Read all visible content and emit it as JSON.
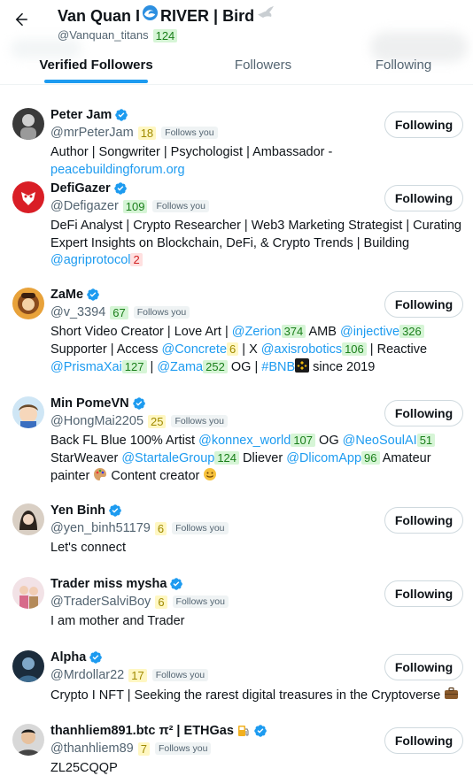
{
  "header": {
    "title_prefix": "Van Quan I",
    "title_suffix": "RIVER | Bird",
    "handle": "@Vanquan_titans",
    "handle_count": "124"
  },
  "tabs": [
    {
      "label": "Verified Followers"
    },
    {
      "label": "Followers"
    },
    {
      "label": "Following"
    }
  ],
  "colors": {
    "accent": "#1d9bf0",
    "verified": "#1d9bf0",
    "count_green_bg": "#d6f5d6",
    "count_yellow_bg": "#fff7c2",
    "count_red_bg": "#ffe0e0"
  },
  "users": [
    {
      "name": "Peter Jam",
      "handle": "@mrPeterJam",
      "count": "18",
      "count_color": "yellow",
      "follows_you": "Follows you",
      "button": "Following",
      "bio": [
        {
          "t": "Author | Songwriter | Psychologist | Ambassador - "
        },
        {
          "t": "peacebuildingforum.org",
          "link": true
        }
      ]
    },
    {
      "name": "DefiGazer",
      "handle": "@Defigazer",
      "count": "109",
      "count_color": "green",
      "follows_you": "Follows you",
      "button": "Following",
      "bio": [
        {
          "t": "DeFi Analyst | Crypto Researcher | Web3 Marketing Strategist | Curating Expert Insights on Blockchain, DeFi, & Crypto Trends | Building "
        },
        {
          "t": "@agriprotocol",
          "link": true
        },
        {
          "t": "2",
          "count": "red"
        }
      ]
    },
    {
      "name": "ZaMe",
      "handle": "@v_3394",
      "count": "67",
      "count_color": "green",
      "follows_you": "Follows you",
      "button": "Following",
      "bio": [
        {
          "t": "Short Video Creator | Love Art | "
        },
        {
          "t": "@Zerion",
          "link": true
        },
        {
          "t": "374",
          "count": "green"
        },
        {
          "t": " AMB "
        },
        {
          "t": "@injective",
          "link": true
        },
        {
          "t": "326",
          "count": "green"
        },
        {
          "t": " Supporter | Access "
        },
        {
          "t": "@Concrete",
          "link": true
        },
        {
          "t": "6",
          "count": "yellow"
        },
        {
          "t": " | X "
        },
        {
          "t": "@axisrobotics",
          "link": true
        },
        {
          "t": "106",
          "count": "green"
        },
        {
          "t": " | Reactive "
        },
        {
          "t": "@PrismaXai",
          "link": true
        },
        {
          "t": "127",
          "count": "green"
        },
        {
          "t": " | "
        },
        {
          "t": "@Zama",
          "link": true
        },
        {
          "t": "252",
          "count": "green"
        },
        {
          "t": " OG | "
        },
        {
          "t": "#BNB",
          "link": true
        },
        {
          "t": "BNB",
          "icon": "bnb-icon"
        },
        {
          "t": " since 2019"
        }
      ]
    },
    {
      "name": "Min PomeVN",
      "handle": "@HongMai2205",
      "count": "25",
      "count_color": "yellow",
      "follows_you": "Follows you",
      "button": "Following",
      "bio": [
        {
          "t": "Back FL Blue 100% Artist "
        },
        {
          "t": "@konnex_world",
          "link": true
        },
        {
          "t": "107",
          "count": "green"
        },
        {
          "t": " OG "
        },
        {
          "t": "@NeoSoulAI",
          "link": true
        },
        {
          "t": "51",
          "count": "green"
        },
        {
          "t": " StarWeaver "
        },
        {
          "t": "@StartaleGroup",
          "link": true
        },
        {
          "t": "124",
          "count": "green"
        },
        {
          "t": " Dliever "
        },
        {
          "t": "@DlicomApp",
          "link": true
        },
        {
          "t": "96",
          "count": "green"
        },
        {
          "t": " Amateur painter "
        },
        {
          "t": "palette",
          "icon": "palette-icon"
        },
        {
          "t": " Content creator "
        },
        {
          "t": "smile",
          "icon": "smile-icon"
        }
      ]
    },
    {
      "name": "Yen Binh",
      "handle": "@yen_binh51179",
      "count": "6",
      "count_color": "yellow",
      "follows_you": "Follows you",
      "button": "Following",
      "bio": [
        {
          "t": "Let's connect"
        }
      ]
    },
    {
      "name": "Trader miss mysha",
      "handle": "@TraderSalviBoy",
      "count": "6",
      "count_color": "yellow",
      "follows_you": "Follows you",
      "button": "Following",
      "bio": [
        {
          "t": "I am mother and Trader"
        }
      ]
    },
    {
      "name": "Alpha",
      "handle": "@Mrdollar22",
      "count": "17",
      "count_color": "yellow",
      "follows_you": "Follows you",
      "button": "Following",
      "bio": [
        {
          "t": "Crypto I NFT | Seeking the rarest digital treasures in the Cryptoverse "
        },
        {
          "t": "briefcase",
          "icon": "briefcase-icon"
        }
      ]
    },
    {
      "name": "thanhliem891.btc π² | ETHGas",
      "handle": "@thanhliem89",
      "count": "7",
      "count_color": "yellow",
      "follows_you": "Follows you",
      "button": "Following",
      "bio": [
        {
          "t": "ZL25CQQP"
        }
      ]
    }
  ]
}
